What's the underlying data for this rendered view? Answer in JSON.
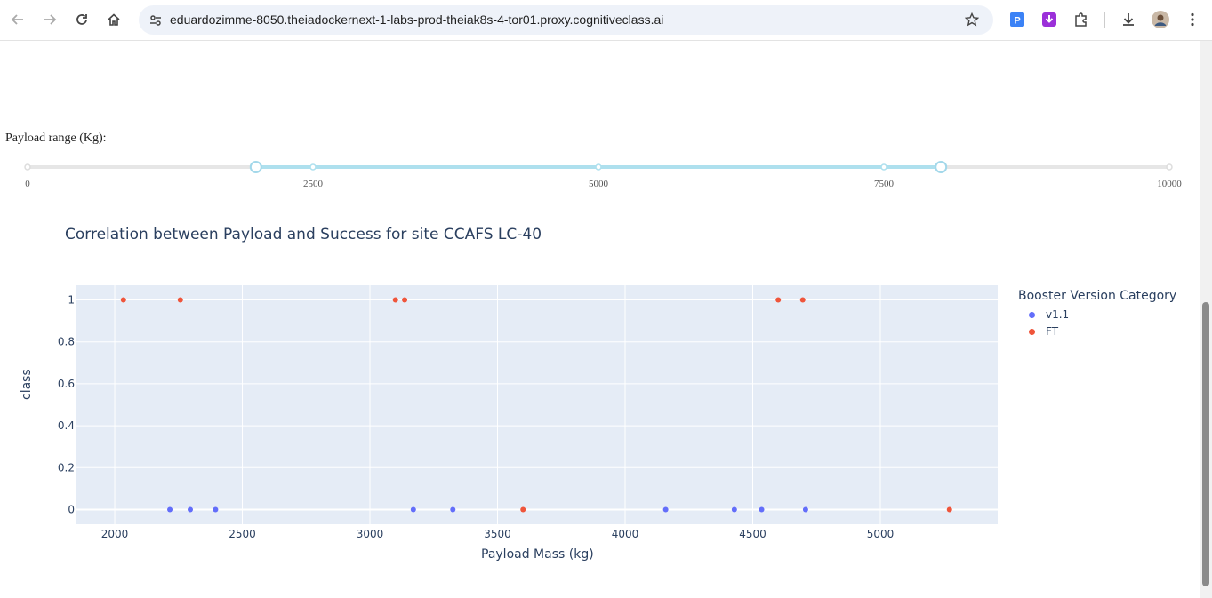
{
  "browser": {
    "url": "eduardozimme-8050.theiadockernext-1-labs-prod-theiak8s-4-tor01.proxy.cognitiveclass.ai"
  },
  "slider": {
    "label": "Payload range (Kg):",
    "min": 0,
    "max": 10000,
    "value_low": 2000,
    "value_high": 8000,
    "marks": [
      "0",
      "2500",
      "5000",
      "7500",
      "10000"
    ],
    "mark_values": [
      0,
      2500,
      5000,
      7500,
      10000
    ],
    "track_color": "#e6e6e6",
    "active_color": "#aee0ee",
    "handle_color": "#a3d8ea"
  },
  "chart_data": {
    "type": "scatter",
    "title": "Correlation between Payload and Success for site CCAFS LC-40",
    "xlabel": "Payload Mass (kg)",
    "ylabel": "class",
    "xlim": [
      1850,
      5460
    ],
    "ylim": [
      -0.07,
      1.07
    ],
    "xticks": [
      2000,
      2500,
      3000,
      3500,
      4000,
      4500,
      5000
    ],
    "xtick_labels": [
      "2000",
      "2500",
      "3000",
      "3500",
      "4000",
      "4500",
      "5000"
    ],
    "yticks": [
      0,
      0.2,
      0.4,
      0.6,
      0.8,
      1
    ],
    "ytick_labels": [
      "0",
      "0.2",
      "0.4",
      "0.6",
      "0.8",
      "1"
    ],
    "grid": true,
    "legend_title": "Booster Version Category",
    "legend_position": "right",
    "series": [
      {
        "name": "v1.1",
        "color": "#636efa",
        "x": [
          2216,
          2296,
          2395,
          3170,
          3325,
          4159,
          4428,
          4535,
          4707
        ],
        "y": [
          0,
          0,
          0,
          0,
          0,
          0,
          0,
          0,
          0
        ]
      },
      {
        "name": "FT",
        "color": "#ef553b",
        "x": [
          2034,
          2257,
          3100,
          3136,
          3600,
          4600,
          4696,
          5271
        ],
        "y": [
          1,
          1,
          1,
          1,
          0,
          1,
          1,
          0
        ]
      }
    ]
  }
}
